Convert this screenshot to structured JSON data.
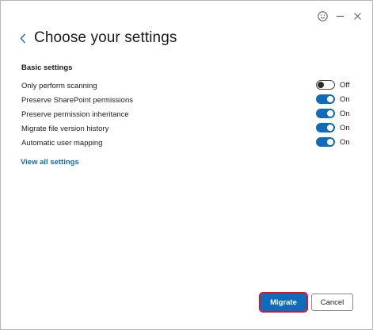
{
  "window": {
    "controls": [
      {
        "name": "feedback",
        "icon": "smiley-icon"
      },
      {
        "name": "minimize",
        "icon": "minimize-icon"
      },
      {
        "name": "close",
        "icon": "close-icon"
      }
    ]
  },
  "header": {
    "back_icon": "chevron-left-icon",
    "title": "Choose your settings"
  },
  "section": {
    "heading": "Basic settings"
  },
  "settings": [
    {
      "label": "Only perform scanning",
      "state": "Off",
      "on": false
    },
    {
      "label": "Preserve SharePoint permissions",
      "state": "On",
      "on": true
    },
    {
      "label": "Preserve permission inheritance",
      "state": "On",
      "on": true
    },
    {
      "label": "Migrate file version history",
      "state": "On",
      "on": true
    },
    {
      "label": "Automatic user mapping",
      "state": "On",
      "on": true
    }
  ],
  "view_all_link": "View all settings",
  "buttons": {
    "primary": "Migrate",
    "secondary": "Cancel"
  },
  "colors": {
    "accent": "#0f6cbd",
    "focus_outline": "#d7152a",
    "text": "#1b1b1b"
  }
}
